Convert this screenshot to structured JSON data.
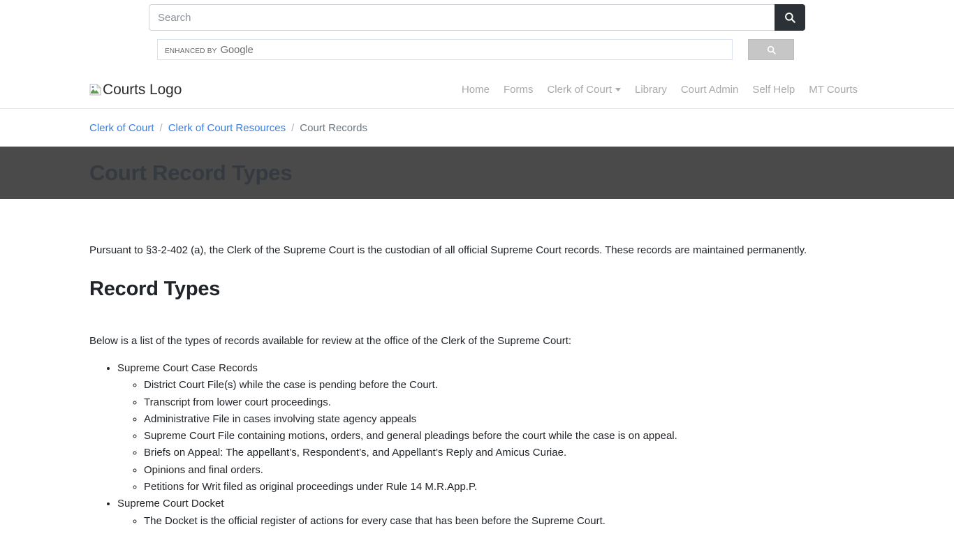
{
  "search": {
    "placeholder": "Search",
    "value": "",
    "submit_icon": "search-icon"
  },
  "google_cse": {
    "enhanced_label": "ENHANCED BY",
    "brand": "Google",
    "value": "",
    "button_icon": "search-icon"
  },
  "navbar": {
    "logo_alt": "Courts Logo",
    "links": [
      {
        "label": "Home",
        "has_caret": false
      },
      {
        "label": "Forms",
        "has_caret": false
      },
      {
        "label": "Clerk of Court",
        "has_caret": true
      },
      {
        "label": "Library",
        "has_caret": false
      },
      {
        "label": "Court Admin",
        "has_caret": false
      },
      {
        "label": "Self Help",
        "has_caret": false
      },
      {
        "label": "MT Courts",
        "has_caret": false
      }
    ]
  },
  "breadcrumb": {
    "items": [
      {
        "label": "Clerk of Court",
        "current": false
      },
      {
        "label": "Clerk of Court Resources",
        "current": false
      },
      {
        "label": "Court Records",
        "current": true
      }
    ],
    "separator": "/"
  },
  "banner": {
    "title": "Court Record Types",
    "background": "#4a4a4a",
    "text_color": "#343a40"
  },
  "main": {
    "lede": "Pursuant to §3-2-402 (a), the Clerk of the Supreme Court is the custodian of all official Supreme Court records. These records are maintained permanently.",
    "section_heading": "Record Types",
    "intro": "Below is a list of the types of records available for review at the office of the Clerk of the Supreme Court:",
    "groups": [
      {
        "label": "Supreme Court Case Records",
        "items": [
          "District Court File(s) while the case is pending before the Court.",
          "Transcript from lower court proceedings.",
          "Administrative File in cases involving state agency appeals",
          "Supreme Court File containing motions, orders, and general pleadings before the court while the case is on appeal.",
          "Briefs on Appeal: The appellant’s, Respondent’s, and Appellant’s Reply and Amicus Curiae.",
          "Opinions and final orders.",
          "Petitions for Writ filed as original proceedings under Rule 14 M.R.App.P."
        ]
      },
      {
        "label": "Supreme Court Docket",
        "items": [
          "The Docket is the official register of actions for every case that has been before the Supreme Court."
        ]
      }
    ]
  },
  "colors": {
    "link": "#3b7ddd",
    "nav_text": "#a9a9a9",
    "search_button": "#2b3137",
    "cse_button": "#c6c6c6"
  }
}
